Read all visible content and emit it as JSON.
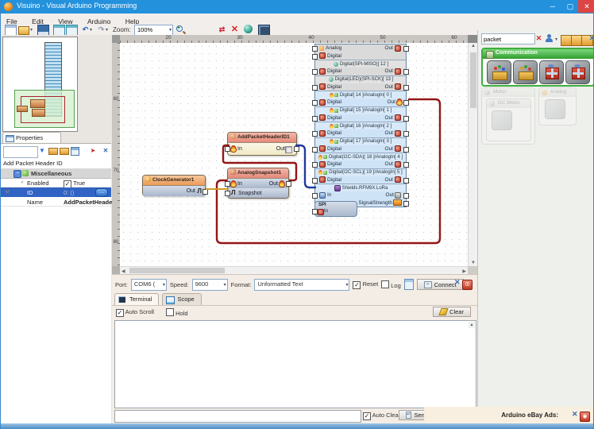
{
  "window": {
    "title": "Visuino - Visual Arduino Programming",
    "controls": {
      "minimize": "─",
      "maximize": "▢",
      "close": "✕"
    }
  },
  "menu": {
    "items": [
      "File",
      "Edit",
      "View",
      "Arduino",
      "Help"
    ]
  },
  "toolbar": {
    "zoom_label": "Zoom:",
    "zoom_value": "100%"
  },
  "properties": {
    "tab_label": "Properties",
    "search_value": "",
    "caption": "Add Packet Header ID",
    "group_label": "Miscellaneous",
    "rows": [
      {
        "name": "Enabled",
        "value": "True",
        "checked": true
      },
      {
        "name": "ID",
        "value": "0: ()",
        "selected": true,
        "button": "…"
      },
      {
        "name": "Name",
        "value": "AddPacketHeade..."
      }
    ]
  },
  "canvas": {
    "ruler_x": [
      "20",
      "30",
      "40",
      "50",
      "60"
    ],
    "ruler_y": [
      "60",
      "70",
      "80"
    ],
    "blocks": {
      "clock": {
        "title": "ClockGenerator1",
        "out_label": "Out",
        "clock_glyph": "Л"
      },
      "packet_header": {
        "title": "AddPacketHeaderID1",
        "in_label": "In",
        "out_label": "Out"
      },
      "snapshot": {
        "title": "AnalogSnapshot1",
        "in_label": "In",
        "out_label": "Out",
        "snapshot_label": "Snapshot",
        "clock_glyph": "Л"
      },
      "board": {
        "pin_label": "Digital",
        "out_label": "Out",
        "top_rows": [
          {
            "label": "Analog",
            "out": "Out",
            "icon": "orange"
          },
          {
            "label": "Digital",
            "out": null,
            "icon": "red"
          }
        ],
        "channels": [
          {
            "style": "gray",
            "header": "Digital(SPI-MISO)[ 12 ]"
          },
          {
            "style": "gray",
            "header": "Digital(LED)(SPI-SCK)[ 13 ]"
          },
          {
            "style": "blue",
            "header": "Digital[ 14 ]/AnalogIn[ 0 ]",
            "wired": true
          },
          {
            "style": "blue",
            "header": "Digital[ 15 ]/AnalogIn[ 1 ]"
          },
          {
            "style": "blue",
            "header": "Digital[ 16 ]/AnalogIn[ 2 ]"
          },
          {
            "style": "blue",
            "header": "Digital[ 17 ]/AnalogIn[ 3 ]"
          },
          {
            "style": "blue",
            "header": "Digital(I2C-SDA)[ 18 ]/AnalogIn[ 4 ]"
          },
          {
            "style": "blue",
            "header": "Digital(I2C-SCL)[ 19 ]/AnalogIn[ 5 ]"
          }
        ],
        "lora": {
          "header": "Shields.RFM9X.LoRa",
          "in_label": "In",
          "out_label": "Out",
          "signal_label": "SignalStrength"
        },
        "spi": {
          "title": "SPI",
          "in_label": "In"
        }
      }
    },
    "wire_colors": {
      "signal_red": "#941616",
      "packet_blue": "#223a9e",
      "clock_orange": "#cf9a2a"
    }
  },
  "palette": {
    "search_value": "packet",
    "categories": [
      {
        "label": "Communication",
        "state": "active",
        "items": [
          "unpacket",
          "unpacket",
          "packet",
          "packet"
        ]
      },
      {
        "label": "Motor",
        "state": "faded",
        "sub_label": "DC Motor"
      },
      {
        "label": "Analog",
        "state": "faded"
      }
    ]
  },
  "terminal": {
    "port_label": "Port:",
    "port_value": "COM6 (",
    "speed_label": "Speed:",
    "speed_value": "9600",
    "format_label": "Format:",
    "format_value": "Unformatted Text",
    "reset_label": "Reset",
    "log_label": "Log",
    "connect_label": "Connect",
    "tabs": [
      "Terminal",
      "Scope"
    ],
    "autoscroll_label": "Auto Scroll",
    "hold_label": "Hold",
    "clear_label": "Clear",
    "autoclear_label": "Auto Clear",
    "send_label": "Send",
    "send_value": "",
    "output_text": ""
  },
  "ads": {
    "label": "Arduino eBay Ads:"
  }
}
